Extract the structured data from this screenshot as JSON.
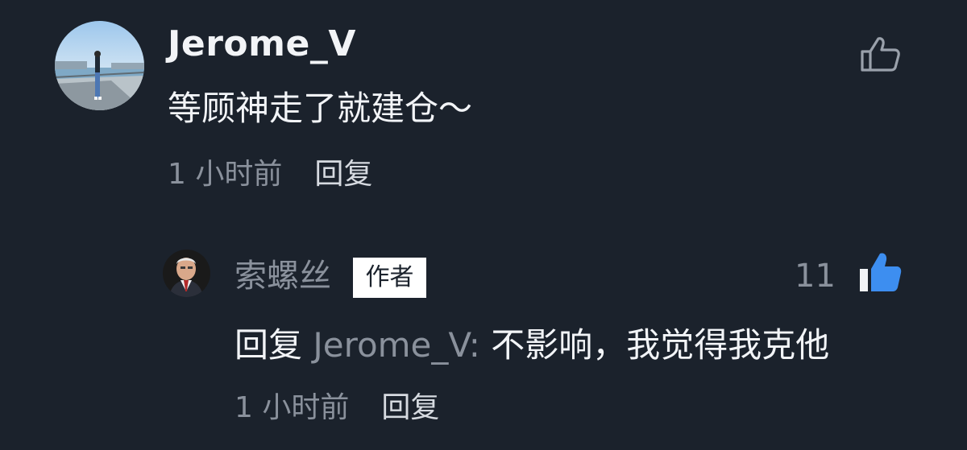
{
  "comment": {
    "author": "Jerome_V",
    "text": "等顾神走了就建仓～",
    "time": "1 小时前",
    "reply_label": "回复",
    "avatar": "avatar-photo-person-waterfront",
    "like_icon": "thumbs-up-outline-icon"
  },
  "reply": {
    "author": "索螺丝",
    "badge": "作者",
    "like_count": "11",
    "like_icon": "thumbs-up-filled-icon",
    "like_color": "#3d8ef0",
    "avatar": "avatar-photo-elderly-man",
    "prefix": "回复",
    "mention": " Jerome_V: ",
    "text": "不影响，我觉得我克他",
    "time": "1 小时前",
    "reply_label": "回复"
  },
  "colors": {
    "background": "#1b222c",
    "text_primary": "#f2f4f7",
    "text_secondary": "#8a919c",
    "like_active": "#3d8ef0"
  }
}
